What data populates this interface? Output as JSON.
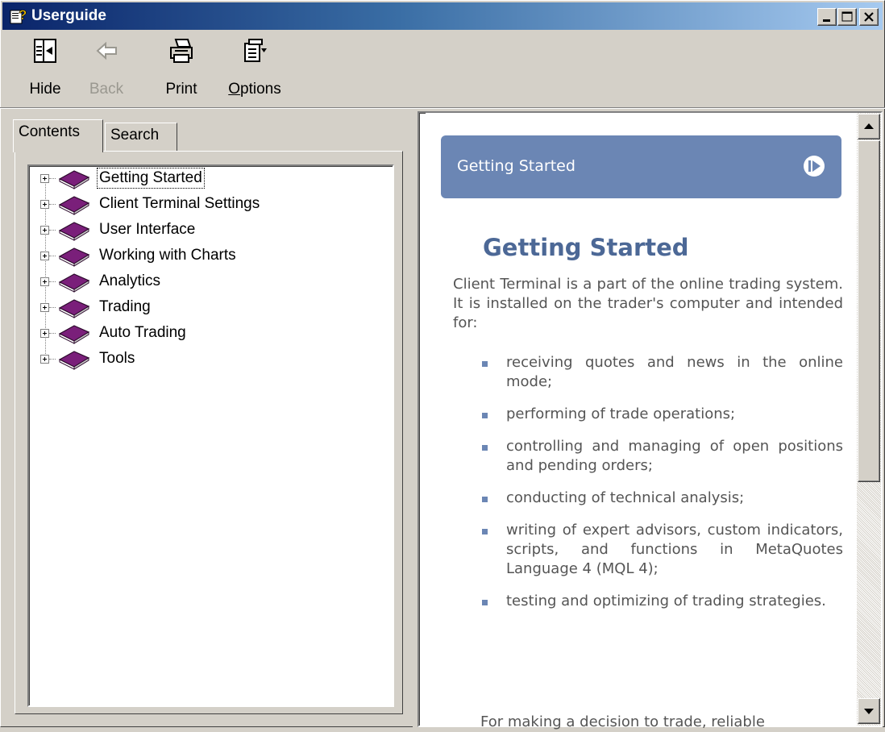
{
  "window": {
    "title": "Userguide"
  },
  "toolbar": {
    "hide_label": "Hide",
    "back_label": "Back",
    "print_label": "Print",
    "options_label": "Options"
  },
  "tabs": {
    "contents": "Contents",
    "search": "Search"
  },
  "tree": {
    "items": [
      {
        "label": "Getting Started",
        "selected": true
      },
      {
        "label": "Client Terminal Settings"
      },
      {
        "label": "User Interface"
      },
      {
        "label": "Working with Charts"
      },
      {
        "label": "Analytics"
      },
      {
        "label": "Trading"
      },
      {
        "label": "Auto Trading"
      },
      {
        "label": "Tools"
      }
    ]
  },
  "content": {
    "banner_title": "Getting Started",
    "page_title": "Getting Started",
    "intro": "Client Terminal is a part of the online trading system. It is installed on the trader's computer and intended for:",
    "bullets": [
      "receiving quotes and news in the online mode;",
      "performing of trade operations;",
      "controlling and managing of open positions and pending orders;",
      "conducting of technical analysis;",
      "writing of expert advisors, custom indicators, scripts, and functions in MetaQuotes Language 4 (MQL 4);",
      "testing and optimizing of trading strategies."
    ],
    "trailing_text": "For making a decision to trade, reliable"
  },
  "colors": {
    "title_gradient_start": "#0a246a",
    "banner": "#6b86b4",
    "heading": "#4c6896",
    "book_icon": "#7a1f7a"
  },
  "icons": {
    "app": "help-book-icon",
    "hide": "hide-pane-icon",
    "back": "back-arrow-icon",
    "print": "printer-icon",
    "options": "options-icon",
    "tree_book": "book-icon",
    "banner_next": "next-arrow-circle-icon"
  }
}
